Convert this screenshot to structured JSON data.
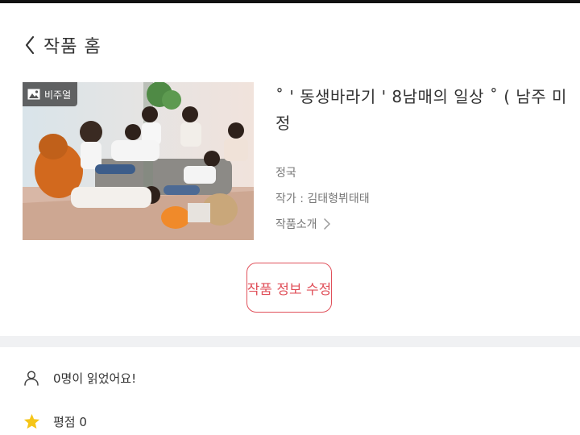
{
  "header": {
    "title": "작품 홈",
    "back_icon": "chevron-left-icon"
  },
  "cover": {
    "badge_label": "비주얼",
    "badge_icon": "image-icon"
  },
  "work": {
    "title": "˚ ' 동생바라기 ' 8남매의 일상 ˚ ( 남주 미정",
    "genre": "정국",
    "author": "작가 : 김태형뷔태태",
    "intro_label": "작품소개",
    "intro_icon": "chevron-right-icon"
  },
  "edit_button": {
    "label": "작품 정보 수정"
  },
  "stats": {
    "readers": "0명이 읽었어요!",
    "readers_icon": "person-icon",
    "rating": "평점 0",
    "rating_icon": "star-icon"
  },
  "colors": {
    "accent": "#e0505a",
    "star": "#f5c518",
    "band": "#f0f1f3"
  }
}
